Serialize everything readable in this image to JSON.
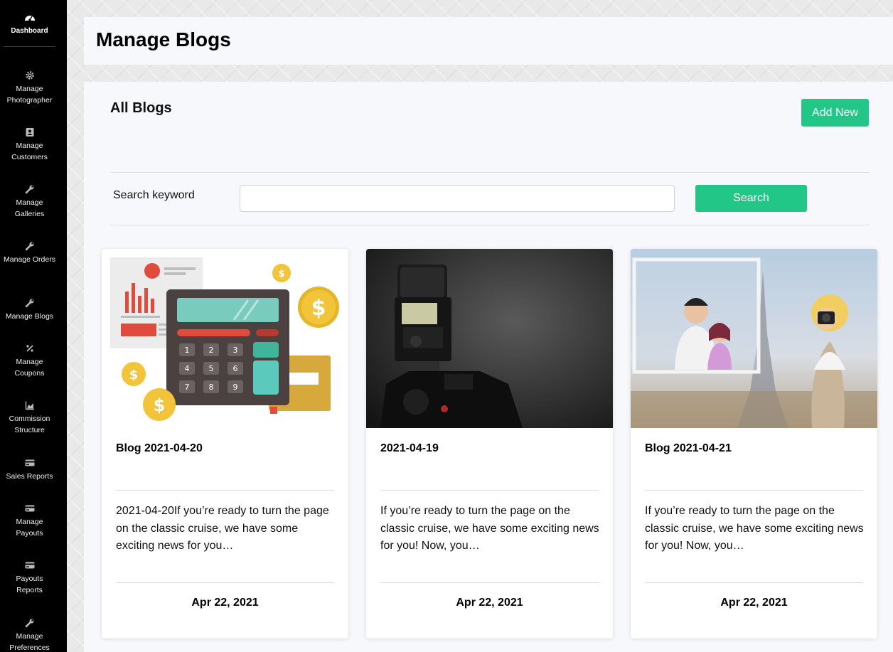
{
  "sidebar": {
    "dashboard": {
      "label": "Dashboard",
      "icon": "gauge-icon"
    },
    "items": [
      {
        "label": "Manage Photographer",
        "icon": "gear-icon"
      },
      {
        "label": "Manage Customers",
        "icon": "contact-icon"
      },
      {
        "label": "Manage Galleries",
        "icon": "wrench-icon"
      },
      {
        "label": "Manage Orders",
        "icon": "wrench-icon"
      },
      {
        "label": "Manage Blogs",
        "icon": "wrench-icon"
      },
      {
        "label": "Manage Coupons",
        "icon": "percent-icon"
      },
      {
        "label": "Commission Structure",
        "icon": "area-chart-icon"
      },
      {
        "label": "Sales Reports",
        "icon": "card-icon"
      },
      {
        "label": "Manage Payouts",
        "icon": "card-icon"
      },
      {
        "label": "Payouts Reports",
        "icon": "card-icon"
      },
      {
        "label": "Manage Preferences",
        "icon": "wrench-icon"
      }
    ]
  },
  "header": {
    "title": "Manage Blogs"
  },
  "main": {
    "section_title": "All Blogs",
    "add_new_label": "Add New",
    "search": {
      "label": "Search keyword",
      "value": "",
      "placeholder": "",
      "button_label": "Search"
    },
    "cards": [
      {
        "title": "Blog 2021-04-20",
        "excerpt": "2021-04-20If you’re ready to turn the page on the classic cruise, we have some exciting news for you…",
        "date": "Apr 22, 2021",
        "image": "calculator-finance-illustration"
      },
      {
        "title": "2021-04-19",
        "excerpt": "If you’re ready to turn the page on the classic cruise, we have some exciting news for you! Now, you…",
        "date": "Apr 22, 2021",
        "image": "camera-flash-photo"
      },
      {
        "title": "Blog 2021-04-21",
        "excerpt": "If you’re ready to turn the page on the classic cruise, we have some exciting news for you! Now, you…",
        "date": "Apr 22, 2021",
        "image": "paris-photographer-illustration"
      }
    ]
  },
  "colors": {
    "accent": "#22c787",
    "sidebar_bg": "#000000",
    "panel_bg": "#f7f8fb"
  }
}
